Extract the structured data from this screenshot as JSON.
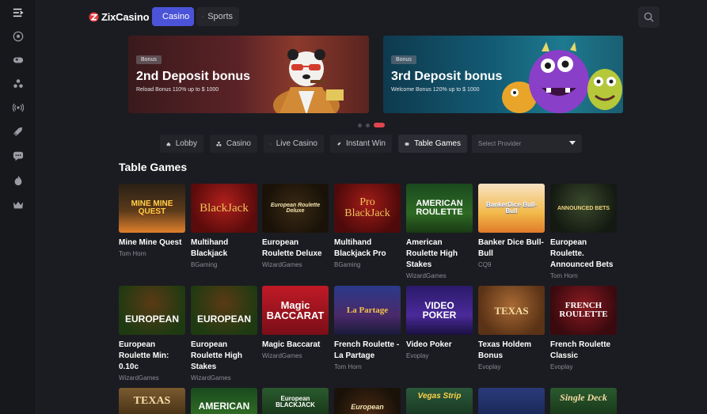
{
  "header": {
    "logo_text": "ZixCasino",
    "tabs": [
      {
        "label": "Casino",
        "active": true
      },
      {
        "label": "Sports",
        "active": false
      }
    ]
  },
  "sidebar": {
    "items": [
      "menu-icon",
      "soccer-ball-icon",
      "gamepad-icon",
      "cards-icon",
      "broadcast-icon",
      "rocket-icon",
      "chat-icon",
      "fire-icon",
      "crown-icon"
    ]
  },
  "banners": [
    {
      "badge": "Bonus",
      "title": "2nd Deposit bonus",
      "subtitle": "Reload Bonus 110% up to $ 1000"
    },
    {
      "badge": "Bonus",
      "title": "3rd Deposit bonus",
      "subtitle": "Welcome Bonus 120% up to $ 1000"
    }
  ],
  "categories": [
    {
      "label": "Lobby",
      "icon": "home-icon"
    },
    {
      "label": "Casino",
      "icon": "cards-icon"
    },
    {
      "label": "Live Casino",
      "icon": "broadcast-icon"
    },
    {
      "label": "Instant Win",
      "icon": "rocket-icon"
    },
    {
      "label": "Table Games",
      "icon": "table-icon",
      "active": true
    }
  ],
  "provider_select": {
    "placeholder": "Select Provider"
  },
  "section_title": "Table Games",
  "games": [
    {
      "name": "Mine Mine Quest",
      "provider": "Tom Horn",
      "art": "MINE MINE QUEST"
    },
    {
      "name": "Multihand Blackjack",
      "provider": "BGaming",
      "art": "BlackJack"
    },
    {
      "name": "European Roulette Deluxe",
      "provider": "WizardGames",
      "art": "European Roulette Deluxe"
    },
    {
      "name": "Multihand Blackjack Pro",
      "provider": "BGaming",
      "art": "Pro BlackJack"
    },
    {
      "name": "American Roulette High Stakes",
      "provider": "WizardGames",
      "art": "AMERICAN ROULETTE"
    },
    {
      "name": "Banker Dice Bull-Bull",
      "provider": "CQ9",
      "art": "BankerDice Bull-Bull"
    },
    {
      "name": "European Roulette. Announced Bets",
      "provider": "Tom Horn",
      "art": "ANNOUNCED BETS"
    },
    {
      "name": "European Roulette Min: 0.10c",
      "provider": "WizardGames",
      "art": "EUROPEAN"
    },
    {
      "name": "European Roulette High Stakes",
      "provider": "WizardGames",
      "art": "EUROPEAN"
    },
    {
      "name": "Magic Baccarat",
      "provider": "WizardGames",
      "art": "Magic BACCARAT"
    },
    {
      "name": "French Roulette - La Partage",
      "provider": "Tom Horn",
      "art": "La Partage"
    },
    {
      "name": "Video Poker",
      "provider": "Evoplay",
      "art": "VIDEO POKER"
    },
    {
      "name": "Texas Holdem Bonus",
      "provider": "Evoplay",
      "art": "TEXAS"
    },
    {
      "name": "French Roulette Classic",
      "provider": "Evoplay",
      "art": "FRENCH ROULETTE"
    }
  ],
  "partial_row_art": [
    "TEXAS",
    "AMERICAN",
    "European BLACKJACK",
    "European",
    "Vegas Strip",
    "",
    "Single Deck"
  ]
}
